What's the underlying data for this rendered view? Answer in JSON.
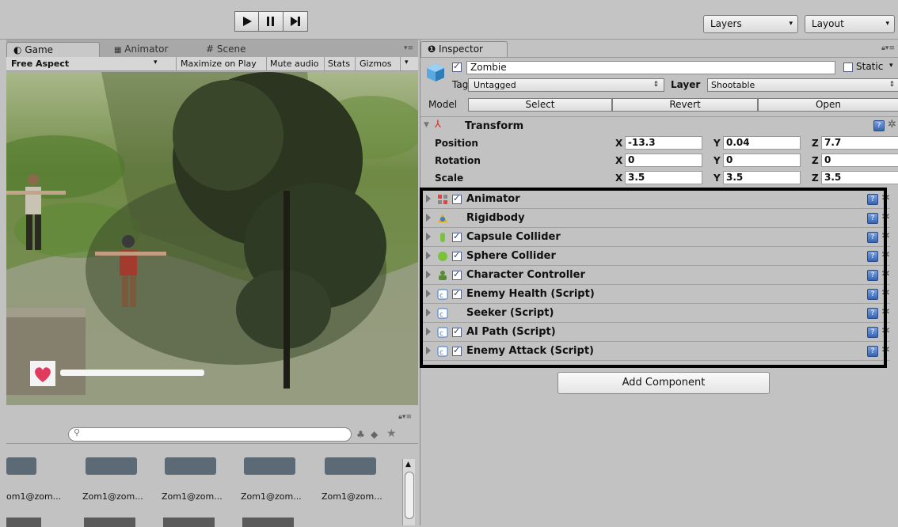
{
  "toolbar": {
    "layers_label": "Layers",
    "layout_label": "Layout"
  },
  "game_panel": {
    "tabs": [
      {
        "label": "Game",
        "icon": "game-icon"
      },
      {
        "label": "Animator",
        "icon": "animator-icon"
      },
      {
        "label": "Scene",
        "icon": "scene-icon"
      }
    ],
    "aspect": "Free Aspect",
    "options": [
      "Maximize on Play",
      "Mute audio",
      "Stats",
      "Gizmos"
    ],
    "health_bar_fill": 1.0
  },
  "project_panel": {
    "assets": [
      "om1@zom...",
      "Zom1@zom...",
      "Zom1@zom...",
      "Zom1@zom...",
      "Zom1@zom..."
    ]
  },
  "inspector": {
    "tab_label": "Inspector",
    "object_name": "Zombie",
    "static_label": "Static",
    "tag_label": "Tag",
    "tag_value": "Untagged",
    "layer_label": "Layer",
    "layer_value": "Shootable",
    "model_label": "Model",
    "model_buttons": [
      "Select",
      "Revert",
      "Open"
    ],
    "transform": {
      "title": "Transform",
      "rows": [
        {
          "label": "Position",
          "x": "-13.3",
          "y": "0.04",
          "z": "7.7"
        },
        {
          "label": "Rotation",
          "x": "0",
          "y": "0",
          "z": "0"
        },
        {
          "label": "Scale",
          "x": "3.5",
          "y": "3.5",
          "z": "3.5"
        }
      ],
      "axis_labels": [
        "X",
        "Y",
        "Z"
      ]
    },
    "components": [
      {
        "name": "Animator",
        "checked": true,
        "icon": "animator-icon"
      },
      {
        "name": "Rigidbody",
        "checked": false,
        "icon": "rigidbody-icon"
      },
      {
        "name": "Capsule Collider",
        "checked": true,
        "icon": "capsule-collider-icon"
      },
      {
        "name": "Sphere Collider",
        "checked": true,
        "icon": "sphere-collider-icon"
      },
      {
        "name": "Character Controller",
        "checked": true,
        "icon": "character-controller-icon"
      },
      {
        "name": "Enemy Health (Script)",
        "checked": true,
        "icon": "script-icon"
      },
      {
        "name": "Seeker (Script)",
        "checked": false,
        "icon": "script-icon"
      },
      {
        "name": "AI Path (Script)",
        "checked": true,
        "icon": "script-icon"
      },
      {
        "name": "Enemy Attack (Script)",
        "checked": true,
        "icon": "script-icon"
      }
    ],
    "add_component_label": "Add Component"
  },
  "colors": {
    "editor_bg": "#c2c2c2",
    "highlight_border": "#000000",
    "health_heart": "#e23a5e"
  }
}
